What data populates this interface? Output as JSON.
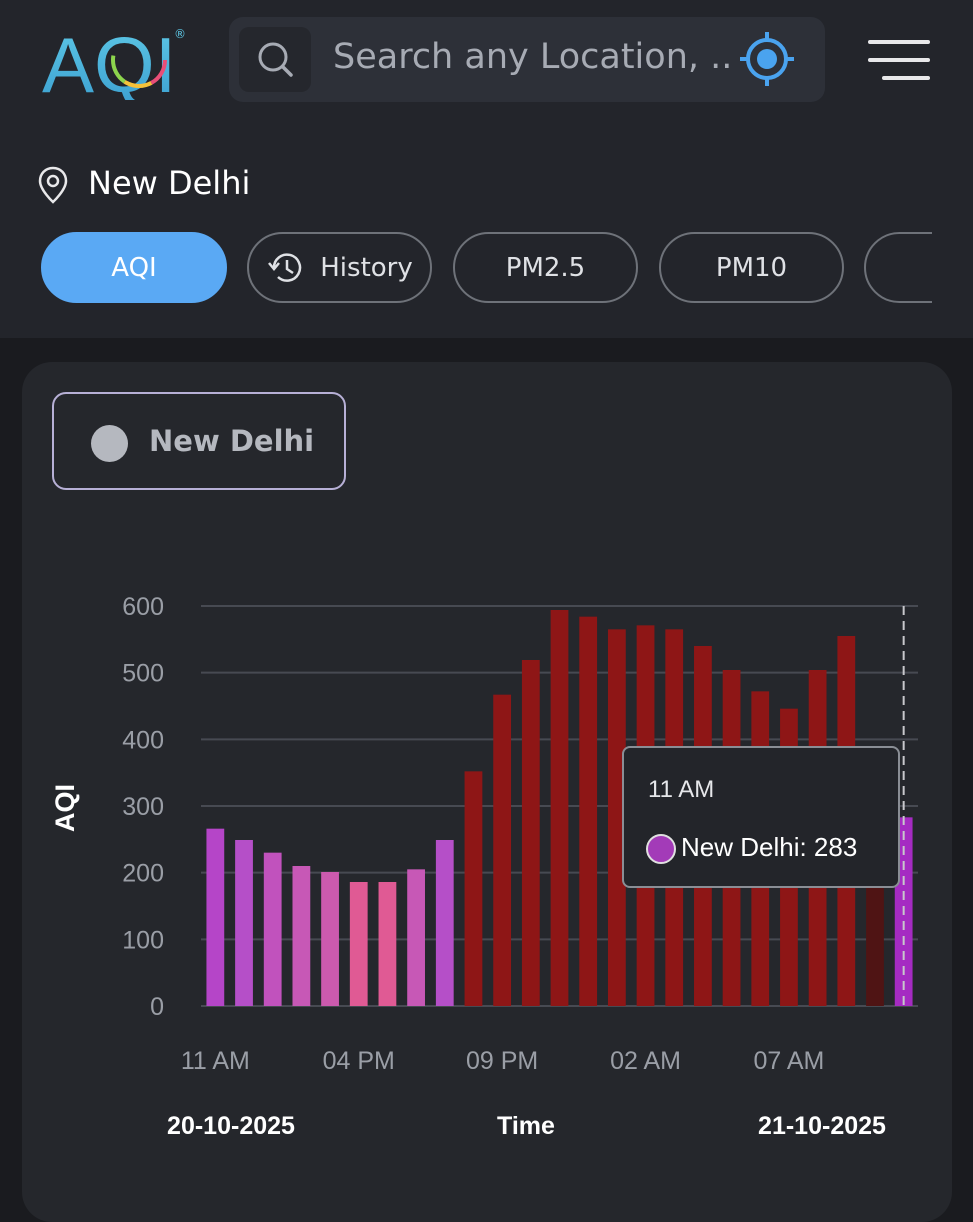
{
  "header": {
    "logo_text": "AQI",
    "logo_mark": "®",
    "search_placeholder": "Search any Location, ..."
  },
  "location": {
    "name": "New Delhi"
  },
  "tabs": [
    {
      "label": "AQI",
      "active": true
    },
    {
      "label": "History",
      "active": false,
      "icon": "history-icon"
    },
    {
      "label": "PM2.5",
      "active": false
    },
    {
      "label": "PM10",
      "active": false
    },
    {
      "label": "",
      "active": false
    }
  ],
  "legend": {
    "label": "New Delhi"
  },
  "tooltip": {
    "time": "11 AM",
    "value_text": "New Delhi: 283"
  },
  "chart_data": {
    "type": "bar",
    "ylabel": "AQI",
    "xlabel": "Time",
    "ylim": [
      0,
      600
    ],
    "yticks": [
      0,
      100,
      200,
      300,
      400,
      500,
      600
    ],
    "xtick_labels": [
      "11 AM",
      "04 PM",
      "09 PM",
      "02 AM",
      "07 AM"
    ],
    "xtick_index": [
      0,
      5,
      10,
      15,
      20
    ],
    "date_start": "20-10-2025",
    "date_end": "21-10-2025",
    "hours": [
      "11 AM",
      "12 PM",
      "01 PM",
      "02 PM",
      "03 PM",
      "04 PM",
      "05 PM",
      "06 PM",
      "07 PM",
      "08 PM",
      "09 PM",
      "10 PM",
      "11 PM",
      "12 AM",
      "01 AM",
      "02 AM",
      "03 AM",
      "04 AM",
      "05 AM",
      "06 AM",
      "07 AM",
      "08 AM",
      "09 AM",
      "10 AM",
      "11 AM"
    ],
    "values": [
      266,
      249,
      230,
      210,
      201,
      186,
      186,
      205,
      249,
      352,
      467,
      519,
      594,
      584,
      565,
      571,
      565,
      540,
      504,
      472,
      446,
      504,
      555,
      358,
      283
    ],
    "colors": [
      "#b545c8",
      "#b54fc8",
      "#c152bd",
      "#c758b6",
      "#cc5aae",
      "#e05a94",
      "#e05a94",
      "#c758b6",
      "#b54fc8",
      "#8e1616",
      "#8e1616",
      "#8e1616",
      "#8e1616",
      "#8e1616",
      "#8e1616",
      "#8e1616",
      "#8e1616",
      "#8e1616",
      "#8e1616",
      "#8e1616",
      "#8e1616",
      "#8e1616",
      "#8e1616",
      "#4f1414",
      "#a52bc2"
    ],
    "grid": true,
    "highlighted_index": 24
  }
}
